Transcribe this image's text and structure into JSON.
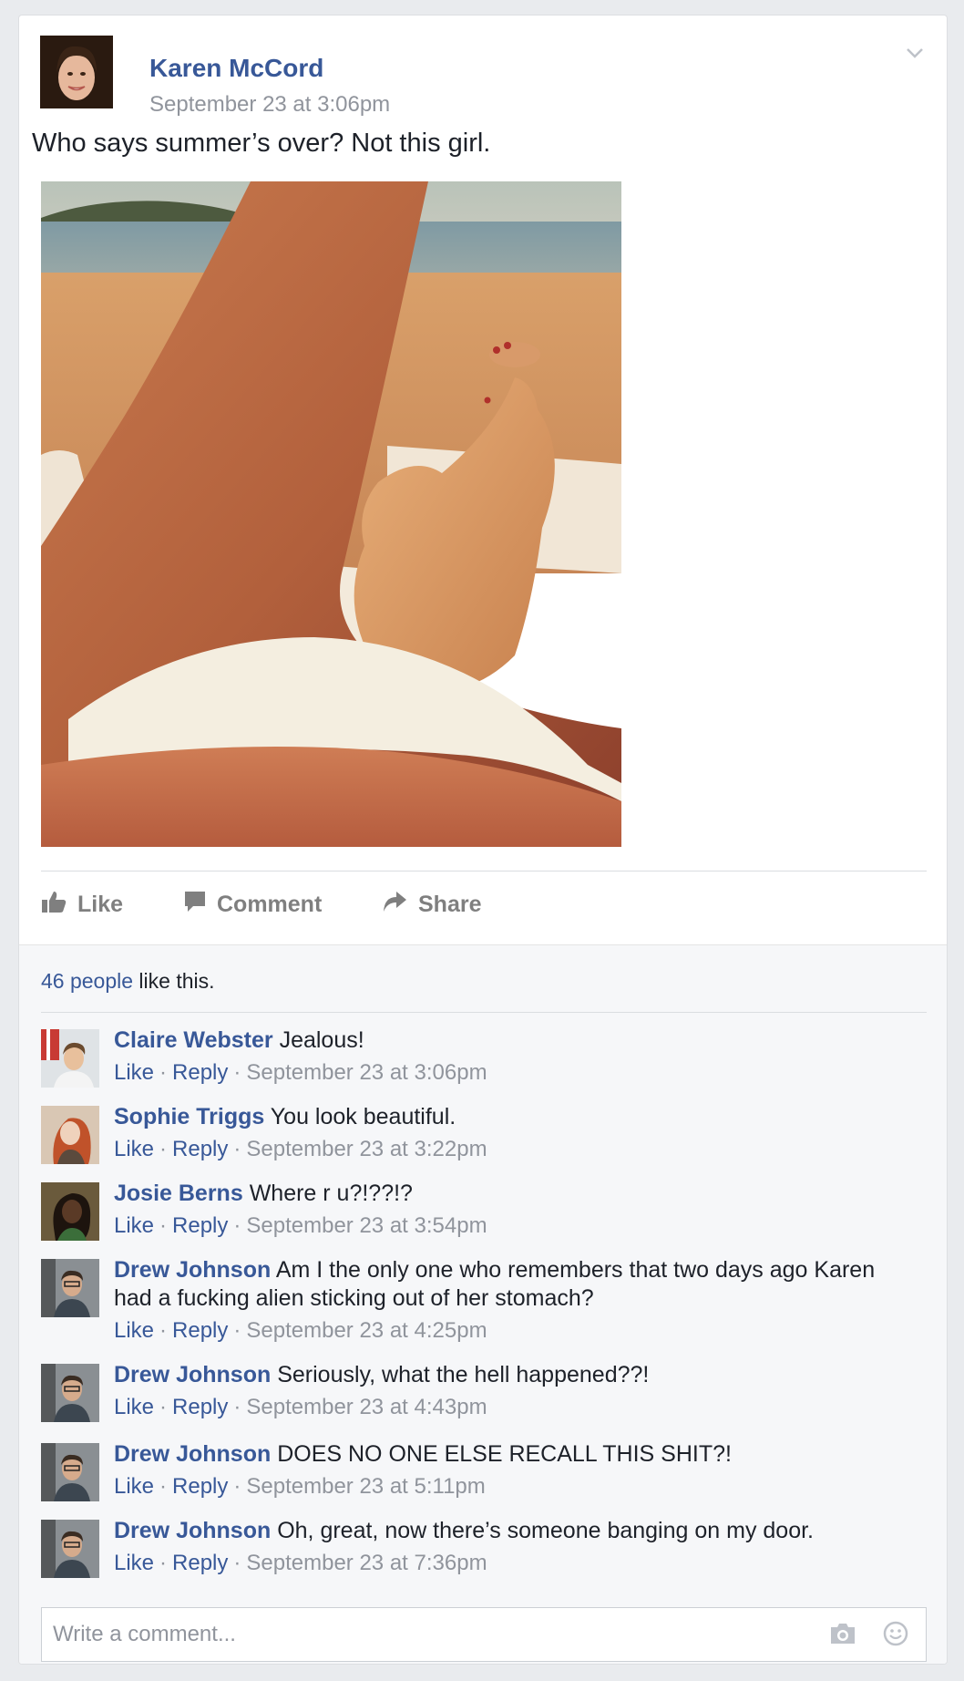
{
  "post": {
    "author": "Karen McCord",
    "timestamp": "September 23 at 3:06pm",
    "text": "Who says summer’s over? Not this girl."
  },
  "actions": {
    "like_label": "Like",
    "comment_label": "Comment",
    "share_label": "Share"
  },
  "likes": {
    "count_link": "46 people",
    "suffix": " like this."
  },
  "comment_meta": {
    "like_label": "Like",
    "reply_label": "Reply",
    "separator": "·"
  },
  "comments": [
    {
      "name": "Claire Webster",
      "text": "Jealous!",
      "time": "September 23 at 3:06pm"
    },
    {
      "name": "Sophie Triggs",
      "text": "You look beautiful.",
      "time": "September 23 at 3:22pm"
    },
    {
      "name": "Josie Berns",
      "text": "Where r u?!??!?",
      "time": "September 23 at 3:54pm"
    },
    {
      "name": "Drew Johnson",
      "text": "Am I the only one who remembers that two days ago Karen had a fucking alien sticking out of her stomach?",
      "time": "September 23 at 4:25pm"
    },
    {
      "name": "Drew Johnson",
      "text": "Seriously, what the hell happened??!",
      "time": "September 23 at 4:43pm"
    },
    {
      "name": "Drew Johnson",
      "text": "DOES NO ONE ELSE RECALL THIS SHIT?!",
      "time": "September 23 at 5:11pm"
    },
    {
      "name": "Drew Johnson",
      "text": "Oh, great, now there’s someone banging on my door.",
      "time": "September 23 at 7:36pm"
    }
  ],
  "composer": {
    "placeholder": "Write a comment..."
  },
  "icons": {
    "menu": "chevron-down-icon",
    "like": "thumbs-up-icon",
    "comment": "speech-bubble-icon",
    "share": "share-arrow-icon",
    "camera": "camera-icon",
    "emoji": "smiley-icon"
  },
  "colors": {
    "link": "#385898",
    "meta": "#90949c",
    "action": "#7f7f7f",
    "background": "#e9ebee"
  }
}
